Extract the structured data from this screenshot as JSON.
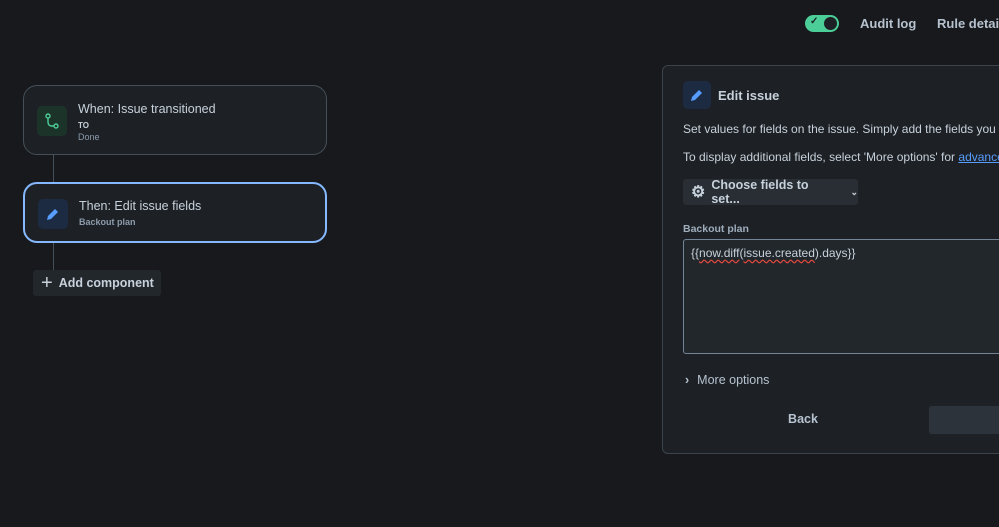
{
  "header": {
    "audit_log": "Audit log",
    "rule_details": "Rule details",
    "rule_enabled": true
  },
  "rule": {
    "trigger": {
      "title": "When: Issue transitioned",
      "label": "TO",
      "value": "Done"
    },
    "action": {
      "title": "Then: Edit issue fields",
      "subtitle": "Backout plan"
    },
    "add_component": "Add component"
  },
  "panel": {
    "title": "Edit issue",
    "description": "Set values for fields on the issue. Simply add the fields you w",
    "hint_prefix": "To display additional fields, select 'More options' for ",
    "hint_link": "advance",
    "choose_fields": "Choose fields to set...",
    "field_label": "Backout plan",
    "field_value": {
      "p1": "{{",
      "p2": "now.diff",
      "p3": "(",
      "p4": "issue.created",
      "p5": ").days}}"
    },
    "more_options": "More options",
    "back": "Back"
  }
}
